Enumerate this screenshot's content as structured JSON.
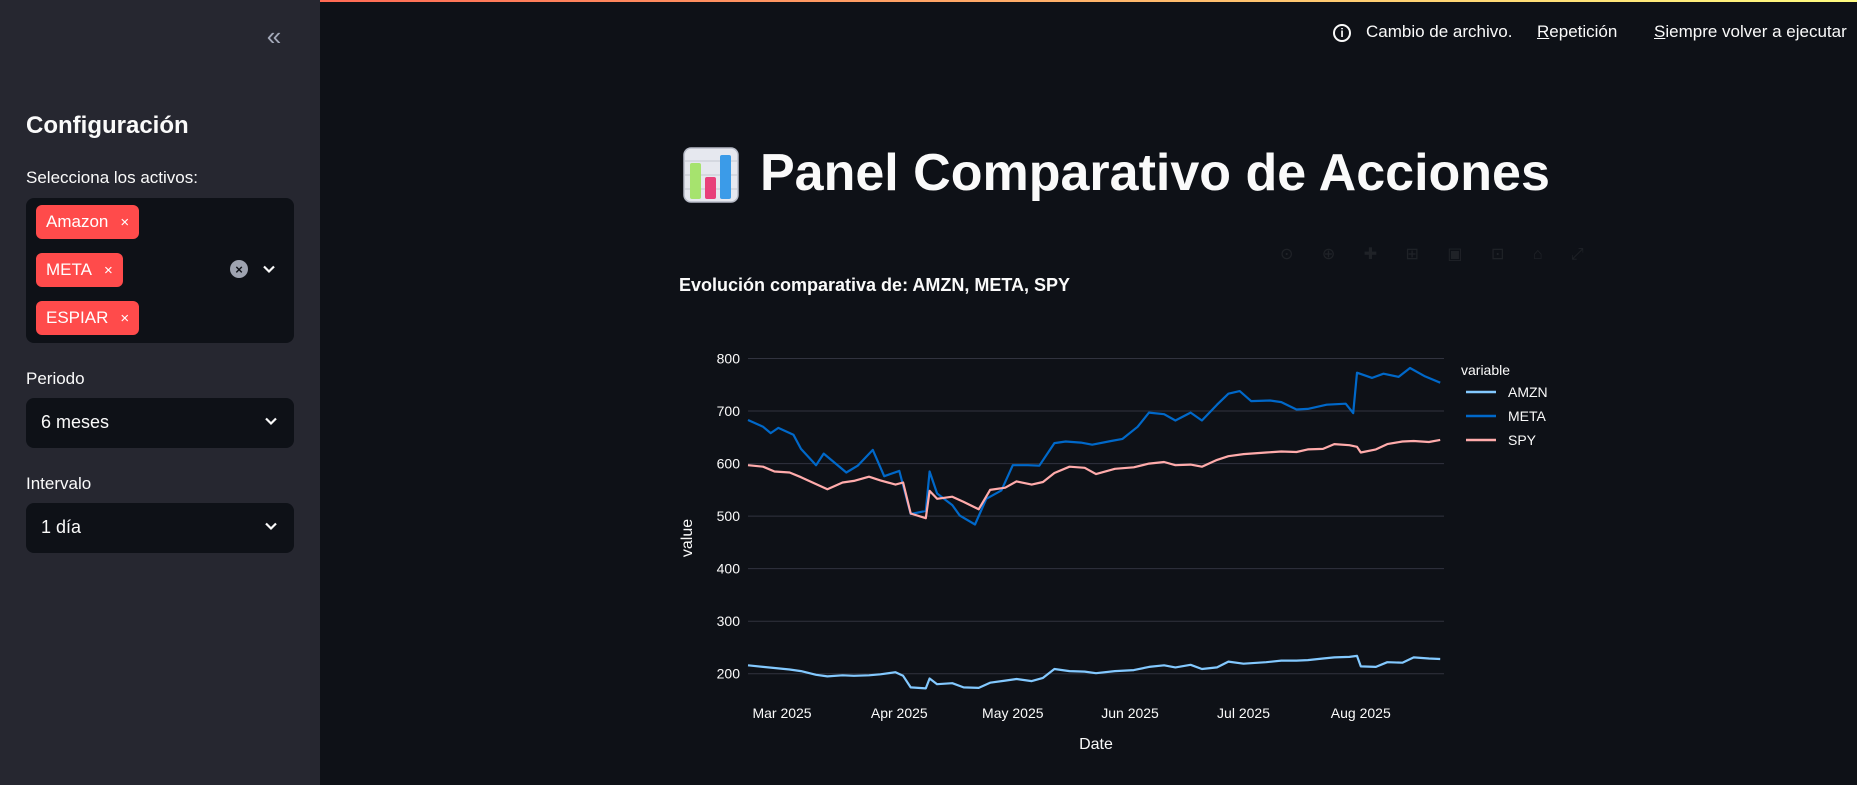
{
  "header": {
    "status_text": "Cambio de archivo.",
    "rerun_label": "Repetición",
    "rerun_key": "R",
    "rerun_rest": "epetición",
    "always_rerun_key": "S",
    "always_rerun_rest": "iempre volver a ejecutar"
  },
  "sidebar": {
    "collapse_icon": "«",
    "title": "Configuración",
    "assets_label": "Selecciona los activos:",
    "selected_assets": [
      "Amazon",
      "META",
      "ESPIAR"
    ],
    "remove_icon": "×",
    "period_label": "Periodo",
    "period_value": "6 meses",
    "interval_label": "Intervalo",
    "interval_value": "1 día"
  },
  "main": {
    "title": "Panel Comparativo de Acciones",
    "chart_heading": "Evolución comparativa de: AMZN, META, SPY"
  },
  "colors": {
    "accent": "#ff4b4b",
    "background": "#0e1117",
    "sidebar": "#262730",
    "amzn": "#83c9ff",
    "meta": "#0068c9",
    "spy": "#ffabab"
  },
  "chart_data": {
    "type": "line",
    "title": "Evolución comparativa de: AMZN, META, SPY",
    "xlabel": "Date",
    "ylabel": "value",
    "legend_title": "variable",
    "legend_position": "right",
    "grid": true,
    "ylim": [
      150,
      820
    ],
    "yticks": [
      200,
      300,
      400,
      500,
      600,
      700,
      800
    ],
    "xlim": [
      "2025-02-20",
      "2025-08-23"
    ],
    "xticks": [
      {
        "date": "2025-03-01",
        "label": "Mar 2025"
      },
      {
        "date": "2025-04-01",
        "label": "Apr 2025"
      },
      {
        "date": "2025-05-01",
        "label": "May 2025"
      },
      {
        "date": "2025-06-01",
        "label": "Jun 2025"
      },
      {
        "date": "2025-07-01",
        "label": "Jul 2025"
      },
      {
        "date": "2025-08-01",
        "label": "Aug 2025"
      }
    ],
    "series": [
      {
        "name": "AMZN",
        "points": [
          [
            "2025-02-20",
            216
          ],
          [
            "2025-02-24",
            213
          ],
          [
            "2025-02-27",
            211
          ],
          [
            "2025-03-03",
            208
          ],
          [
            "2025-03-06",
            205
          ],
          [
            "2025-03-10",
            198
          ],
          [
            "2025-03-13",
            195
          ],
          [
            "2025-03-17",
            197
          ],
          [
            "2025-03-20",
            196
          ],
          [
            "2025-03-24",
            197
          ],
          [
            "2025-03-27",
            199
          ],
          [
            "2025-03-31",
            203
          ],
          [
            "2025-04-02",
            196
          ],
          [
            "2025-04-04",
            174
          ],
          [
            "2025-04-08",
            172
          ],
          [
            "2025-04-09",
            191
          ],
          [
            "2025-04-11",
            180
          ],
          [
            "2025-04-15",
            182
          ],
          [
            "2025-04-18",
            174
          ],
          [
            "2025-04-22",
            173
          ],
          [
            "2025-04-25",
            183
          ],
          [
            "2025-04-29",
            187
          ],
          [
            "2025-05-02",
            190
          ],
          [
            "2025-05-06",
            186
          ],
          [
            "2025-05-09",
            192
          ],
          [
            "2025-05-12",
            209
          ],
          [
            "2025-05-16",
            205
          ],
          [
            "2025-05-20",
            204
          ],
          [
            "2025-05-23",
            201
          ],
          [
            "2025-05-28",
            205
          ],
          [
            "2025-06-02",
            207
          ],
          [
            "2025-06-06",
            213
          ],
          [
            "2025-06-10",
            216
          ],
          [
            "2025-06-13",
            212
          ],
          [
            "2025-06-17",
            217
          ],
          [
            "2025-06-20",
            209
          ],
          [
            "2025-06-24",
            212
          ],
          [
            "2025-06-27",
            223
          ],
          [
            "2025-07-01",
            219
          ],
          [
            "2025-07-07",
            222
          ],
          [
            "2025-07-11",
            225
          ],
          [
            "2025-07-15",
            225
          ],
          [
            "2025-07-18",
            226
          ],
          [
            "2025-07-22",
            229
          ],
          [
            "2025-07-25",
            231
          ],
          [
            "2025-07-29",
            232
          ],
          [
            "2025-07-31",
            234
          ],
          [
            "2025-08-01",
            214
          ],
          [
            "2025-08-05",
            213
          ],
          [
            "2025-08-08",
            222
          ],
          [
            "2025-08-12",
            221
          ],
          [
            "2025-08-15",
            231
          ],
          [
            "2025-08-19",
            229
          ],
          [
            "2025-08-22",
            228
          ]
        ]
      },
      {
        "name": "META",
        "points": [
          [
            "2025-02-20",
            683
          ],
          [
            "2025-02-24",
            670
          ],
          [
            "2025-02-26",
            658
          ],
          [
            "2025-02-28",
            668
          ],
          [
            "2025-03-04",
            655
          ],
          [
            "2025-03-06",
            628
          ],
          [
            "2025-03-10",
            597
          ],
          [
            "2025-03-12",
            619
          ],
          [
            "2025-03-14",
            607
          ],
          [
            "2025-03-18",
            583
          ],
          [
            "2025-03-21",
            596
          ],
          [
            "2025-03-25",
            626
          ],
          [
            "2025-03-28",
            576
          ],
          [
            "2025-04-01",
            586
          ],
          [
            "2025-04-03",
            531
          ],
          [
            "2025-04-04",
            504
          ],
          [
            "2025-04-08",
            510
          ],
          [
            "2025-04-09",
            585
          ],
          [
            "2025-04-11",
            543
          ],
          [
            "2025-04-15",
            521
          ],
          [
            "2025-04-17",
            501
          ],
          [
            "2025-04-21",
            484
          ],
          [
            "2025-04-24",
            533
          ],
          [
            "2025-04-28",
            549
          ],
          [
            "2025-05-01",
            597
          ],
          [
            "2025-05-05",
            597
          ],
          [
            "2025-05-08",
            596
          ],
          [
            "2025-05-12",
            639
          ],
          [
            "2025-05-15",
            642
          ],
          [
            "2025-05-19",
            640
          ],
          [
            "2025-05-22",
            636
          ],
          [
            "2025-05-27",
            643
          ],
          [
            "2025-05-30",
            647
          ],
          [
            "2025-06-03",
            670
          ],
          [
            "2025-06-06",
            697
          ],
          [
            "2025-06-10",
            694
          ],
          [
            "2025-06-13",
            682
          ],
          [
            "2025-06-17",
            697
          ],
          [
            "2025-06-20",
            682
          ],
          [
            "2025-06-24",
            712
          ],
          [
            "2025-06-27",
            733
          ],
          [
            "2025-06-30",
            738
          ],
          [
            "2025-07-03",
            719
          ],
          [
            "2025-07-08",
            720
          ],
          [
            "2025-07-11",
            717
          ],
          [
            "2025-07-15",
            703
          ],
          [
            "2025-07-18",
            704
          ],
          [
            "2025-07-23",
            712
          ],
          [
            "2025-07-28",
            714
          ],
          [
            "2025-07-30",
            696
          ],
          [
            "2025-07-31",
            773
          ],
          [
            "2025-08-04",
            763
          ],
          [
            "2025-08-07",
            771
          ],
          [
            "2025-08-11",
            765
          ],
          [
            "2025-08-14",
            782
          ],
          [
            "2025-08-18",
            766
          ],
          [
            "2025-08-22",
            754
          ]
        ]
      },
      {
        "name": "SPY",
        "points": [
          [
            "2025-02-20",
            597
          ],
          [
            "2025-02-24",
            594
          ],
          [
            "2025-02-27",
            585
          ],
          [
            "2025-03-03",
            583
          ],
          [
            "2025-03-06",
            574
          ],
          [
            "2025-03-10",
            561
          ],
          [
            "2025-03-13",
            551
          ],
          [
            "2025-03-17",
            564
          ],
          [
            "2025-03-20",
            567
          ],
          [
            "2025-03-24",
            575
          ],
          [
            "2025-03-27",
            568
          ],
          [
            "2025-03-31",
            560
          ],
          [
            "2025-04-02",
            564
          ],
          [
            "2025-04-04",
            505
          ],
          [
            "2025-04-08",
            496
          ],
          [
            "2025-04-09",
            548
          ],
          [
            "2025-04-11",
            533
          ],
          [
            "2025-04-15",
            537
          ],
          [
            "2025-04-18",
            527
          ],
          [
            "2025-04-22",
            513
          ],
          [
            "2025-04-25",
            550
          ],
          [
            "2025-04-29",
            554
          ],
          [
            "2025-05-02",
            566
          ],
          [
            "2025-05-06",
            560
          ],
          [
            "2025-05-09",
            565
          ],
          [
            "2025-05-12",
            582
          ],
          [
            "2025-05-16",
            594
          ],
          [
            "2025-05-20",
            592
          ],
          [
            "2025-05-23",
            580
          ],
          [
            "2025-05-28",
            590
          ],
          [
            "2025-06-02",
            593
          ],
          [
            "2025-06-06",
            600
          ],
          [
            "2025-06-10",
            603
          ],
          [
            "2025-06-13",
            597
          ],
          [
            "2025-06-17",
            598
          ],
          [
            "2025-06-20",
            594
          ],
          [
            "2025-06-24",
            607
          ],
          [
            "2025-06-27",
            614
          ],
          [
            "2025-07-01",
            618
          ],
          [
            "2025-07-07",
            621
          ],
          [
            "2025-07-11",
            623
          ],
          [
            "2025-07-15",
            622
          ],
          [
            "2025-07-18",
            627
          ],
          [
            "2025-07-22",
            628
          ],
          [
            "2025-07-25",
            637
          ],
          [
            "2025-07-29",
            635
          ],
          [
            "2025-07-31",
            632
          ],
          [
            "2025-08-01",
            621
          ],
          [
            "2025-08-05",
            627
          ],
          [
            "2025-08-08",
            637
          ],
          [
            "2025-08-12",
            642
          ],
          [
            "2025-08-15",
            643
          ],
          [
            "2025-08-19",
            641
          ],
          [
            "2025-08-22",
            645
          ]
        ]
      }
    ]
  }
}
